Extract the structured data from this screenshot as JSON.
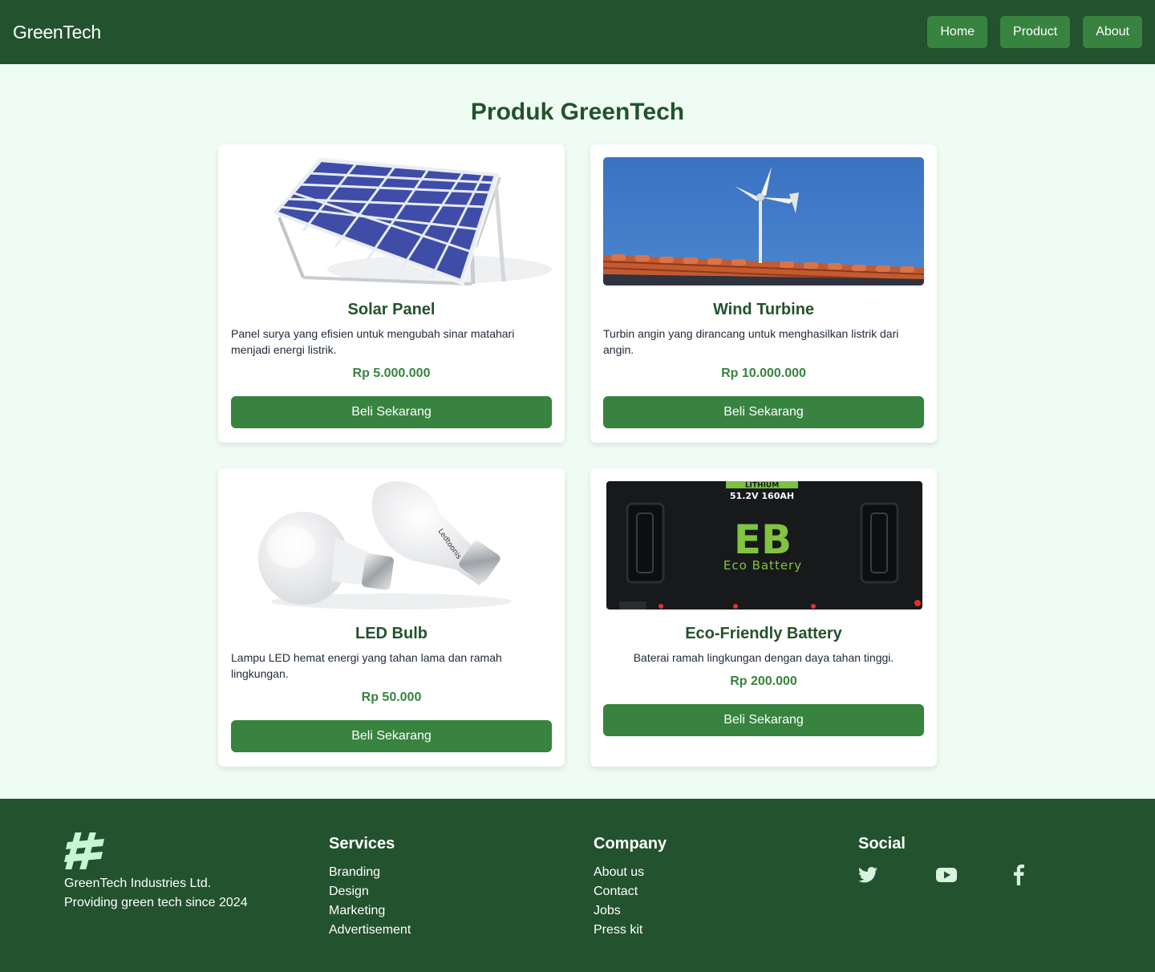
{
  "navbar": {
    "brand": "GreenTech",
    "links": [
      "Home",
      "Product",
      "About"
    ]
  },
  "main": {
    "title": "Produk GreenTech",
    "products": [
      {
        "name": "Solar Panel",
        "description": "Panel surya yang efisien untuk mengubah sinar matahari menjadi energi listrik.",
        "price": "Rp 5.000.000",
        "button": "Beli Sekarang"
      },
      {
        "name": "Wind Turbine",
        "description": "Turbin angin yang dirancang untuk menghasilkan listrik dari angin.",
        "price": "Rp 10.000.000",
        "button": "Beli Sekarang"
      },
      {
        "name": "LED Bulb",
        "description": "Lampu LED hemat energi yang tahan lama dan ramah lingkungan.",
        "price": "Rp 50.000",
        "button": "Beli Sekarang"
      },
      {
        "name": "Eco-Friendly Battery",
        "description": "Baterai ramah lingkungan dengan daya tahan tinggi.",
        "price": "Rp 200.000",
        "button": "Beli Sekarang"
      }
    ],
    "battery_image": {
      "label_top": "LITHIUM",
      "spec": "51.2V  160AH",
      "logo": "EB",
      "brand": "Eco Battery"
    }
  },
  "footer": {
    "company_name": "GreenTech Industries Ltd.",
    "tagline": "Providing green tech since 2024",
    "services": {
      "heading": "Services",
      "links": [
        "Branding",
        "Design",
        "Marketing",
        "Advertisement"
      ]
    },
    "company": {
      "heading": "Company",
      "links": [
        "About us",
        "Contact",
        "Jobs",
        "Press kit"
      ]
    },
    "social": {
      "heading": "Social",
      "icons": [
        "twitter-icon",
        "youtube-icon",
        "facebook-icon"
      ]
    }
  },
  "colors": {
    "nav_bg": "#23522e",
    "accent": "#38833f",
    "page_bg": "#effcf3",
    "footer_logo": "#c7f5d6"
  }
}
